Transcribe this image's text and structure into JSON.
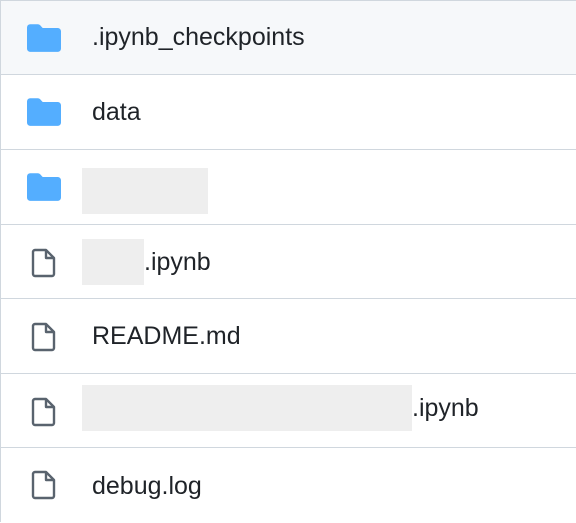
{
  "file_list": {
    "items": [
      {
        "type": "folder",
        "icon": "folder-icon",
        "name": ".ipynb_checkpoints"
      },
      {
        "type": "folder",
        "icon": "folder-icon",
        "name": "data"
      },
      {
        "type": "folder",
        "icon": "folder-icon",
        "name": ""
      },
      {
        "type": "file",
        "icon": "file-icon",
        "name_suffix": ".ipynb"
      },
      {
        "type": "file",
        "icon": "file-icon",
        "name": "README.md"
      },
      {
        "type": "file",
        "icon": "file-icon",
        "name_suffix": ".ipynb"
      },
      {
        "type": "file",
        "icon": "file-icon",
        "name": "debug.log"
      }
    ]
  },
  "colors": {
    "folder": "#54aeff",
    "file_icon": "#59636e",
    "border": "#d0d7de",
    "text": "#1f2328",
    "first_row_bg": "#f6f8fa",
    "redaction": "#eeeeee"
  }
}
